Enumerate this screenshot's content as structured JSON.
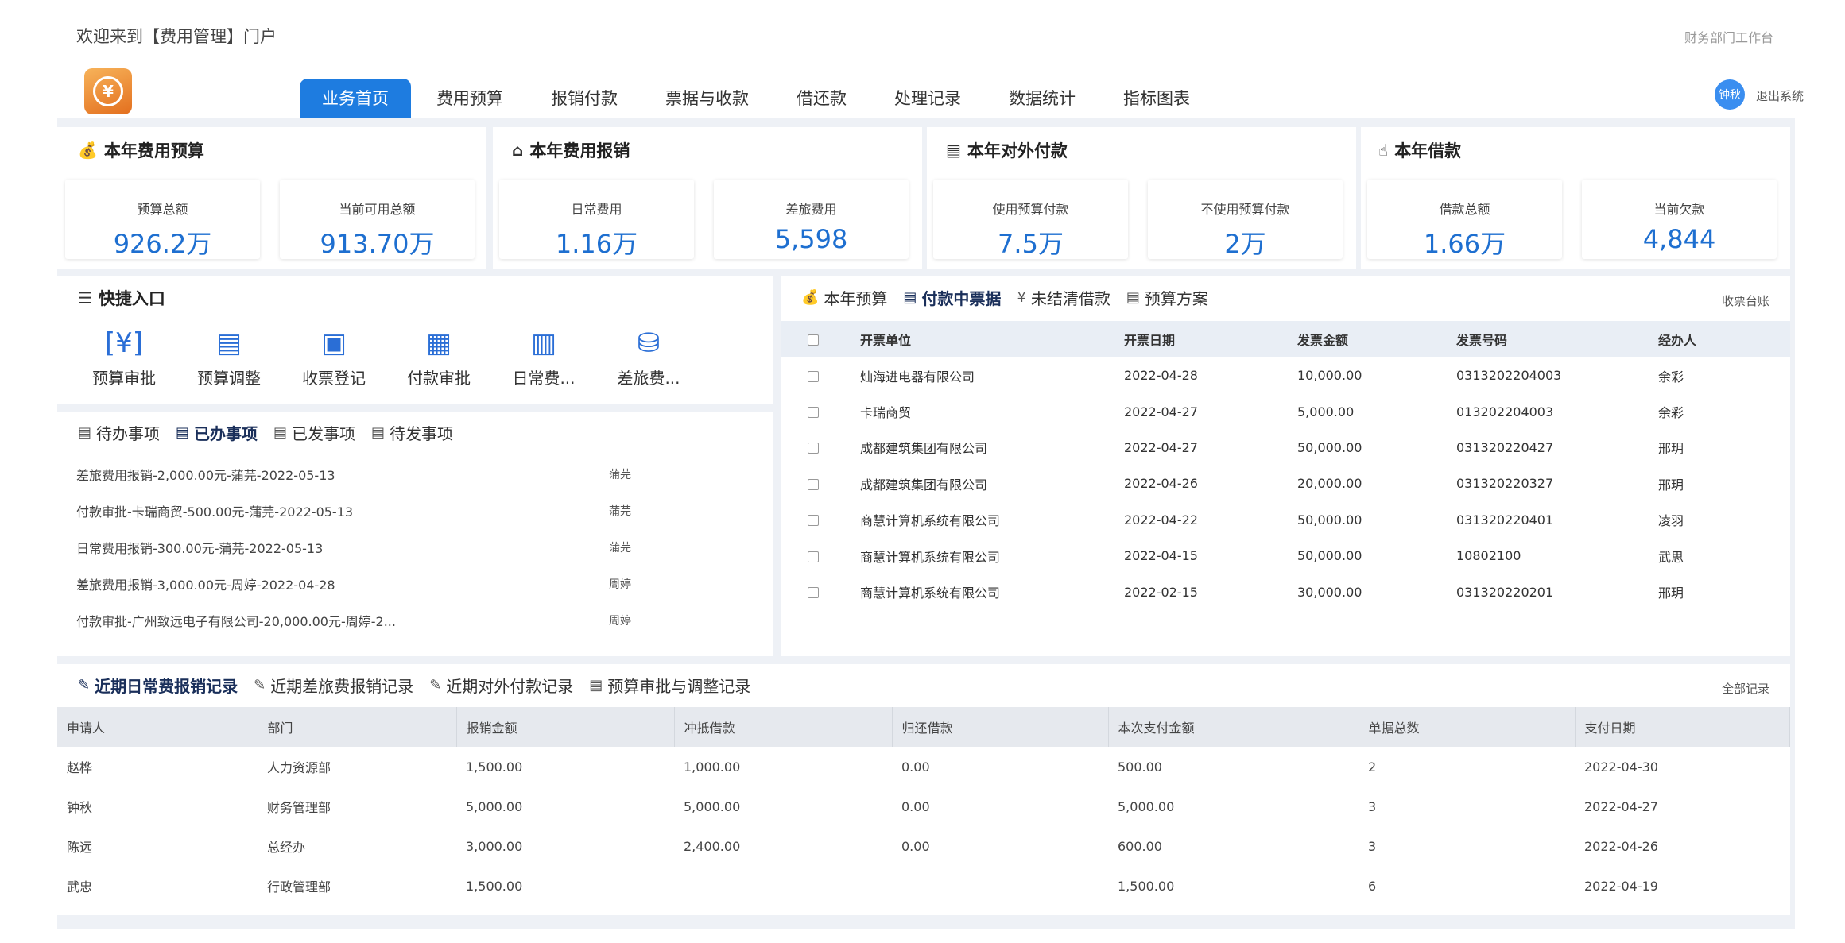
{
  "header": {
    "welcome": "欢迎来到【费用管理】门户",
    "workbench": "财务部门工作台",
    "user_name": "钟秋",
    "logout": "退出系统"
  },
  "nav": [
    {
      "label": "业务首页",
      "active": true
    },
    {
      "label": "费用预算"
    },
    {
      "label": "报销付款"
    },
    {
      "label": "票据与收款"
    },
    {
      "label": "借还款"
    },
    {
      "label": "处理记录"
    },
    {
      "label": "数据统计"
    },
    {
      "label": "指标图表"
    }
  ],
  "cards": [
    {
      "title": "本年费用预算",
      "icon": "money-bag-icon",
      "stats": [
        {
          "label": "预算总额",
          "value": "926.2万"
        },
        {
          "label": "当前可用总额",
          "value": "913.70万"
        }
      ]
    },
    {
      "title": "本年费用报销",
      "icon": "house-icon",
      "stats": [
        {
          "label": "日常费用",
          "value": "1.16万"
        },
        {
          "label": "差旅费用",
          "value": "5,598"
        }
      ]
    },
    {
      "title": "本年对外付款",
      "icon": "newspaper-icon",
      "stats": [
        {
          "label": "使用预算付款",
          "value": "7.5万"
        },
        {
          "label": "不使用预算付款",
          "value": "2万"
        }
      ]
    },
    {
      "title": "本年借款",
      "icon": "hand-money-icon",
      "stats": [
        {
          "label": "借款总额",
          "value": "1.66万"
        },
        {
          "label": "当前欠款",
          "value": "4,844"
        }
      ]
    }
  ],
  "quick": {
    "title": "快捷入口",
    "items": [
      {
        "label": "预算审批",
        "icon": "yen-scan-icon"
      },
      {
        "label": "预算调整",
        "icon": "document-icon"
      },
      {
        "label": "收票登记",
        "icon": "wallet-icon"
      },
      {
        "label": "付款审批",
        "icon": "newspaper-icon"
      },
      {
        "label": "日常费...",
        "icon": "receipt-icon"
      },
      {
        "label": "差旅费...",
        "icon": "coins-icon"
      }
    ]
  },
  "todo": {
    "tabs": [
      {
        "label": "待办事项"
      },
      {
        "label": "已办事项",
        "active": true
      },
      {
        "label": "已发事项"
      },
      {
        "label": "待发事项"
      }
    ],
    "rows": [
      {
        "text": "差旅费用报销-2,000.00元-蒲芫-2022-05-13",
        "person": "蒲芫"
      },
      {
        "text": "付款审批-卡瑞商贸-500.00元-蒲芫-2022-05-13",
        "person": "蒲芫"
      },
      {
        "text": "日常费用报销-300.00元-蒲芫-2022-05-13",
        "person": "蒲芫"
      },
      {
        "text": "差旅费用报销-3,000.00元-周婷-2022-04-28",
        "person": "周婷"
      },
      {
        "text": "付款审批-广州致远电子有限公司-20,000.00元-周婷-2...",
        "person": "周婷"
      }
    ]
  },
  "invoice": {
    "tabs": [
      {
        "label": "本年预算",
        "icon": "money-bag-icon"
      },
      {
        "label": "付款中票据",
        "icon": "receipt-icon",
        "active": true
      },
      {
        "label": "未结清借款",
        "icon": "yen-circle-icon"
      },
      {
        "label": "预算方案",
        "icon": "document-icon"
      }
    ],
    "link": "收票台账",
    "columns": [
      "开票单位",
      "开票日期",
      "发票金额",
      "发票号码",
      "经办人"
    ],
    "rows": [
      [
        "灿海进电器有限公司",
        "2022-04-28",
        "10,000.00",
        "0313202204003",
        "余彩"
      ],
      [
        "卡瑞商贸",
        "2022-04-27",
        "5,000.00",
        "013202204003",
        "余彩"
      ],
      [
        "成都建筑集团有限公司",
        "2022-04-27",
        "50,000.00",
        "031320220427",
        "邢玥"
      ],
      [
        "成都建筑集团有限公司",
        "2022-04-26",
        "20,000.00",
        "031320220327",
        "邢玥"
      ],
      [
        "商慧计算机系统有限公司",
        "2022-04-22",
        "50,000.00",
        "031320220401",
        "凌羽"
      ],
      [
        "商慧计算机系统有限公司",
        "2022-04-15",
        "50,000.00",
        "10802100",
        "武思"
      ],
      [
        "商慧计算机系统有限公司",
        "2022-02-15",
        "30,000.00",
        "031320220201",
        "邢玥"
      ]
    ]
  },
  "records": {
    "tabs": [
      {
        "label": "近期日常费报销记录",
        "active": true
      },
      {
        "label": "近期差旅费报销记录"
      },
      {
        "label": "近期对外付款记录"
      },
      {
        "label": "预算审批与调整记录"
      }
    ],
    "link": "全部记录",
    "columns": [
      "申请人",
      "部门",
      "报销金额",
      "冲抵借款",
      "归还借款",
      "本次支付金额",
      "单据总数",
      "支付日期"
    ],
    "rows": [
      [
        "赵桦",
        "人力资源部",
        "1,500.00",
        "1,000.00",
        "0.00",
        "500.00",
        "2",
        "2022-04-30"
      ],
      [
        "钟秋",
        "财务管理部",
        "5,000.00",
        "5,000.00",
        "0.00",
        "5,000.00",
        "3",
        "2022-04-27"
      ],
      [
        "陈远",
        "总经办",
        "3,000.00",
        "2,400.00",
        "0.00",
        "600.00",
        "3",
        "2022-04-26"
      ],
      [
        "武忠",
        "行政管理部",
        "1,500.00",
        "",
        "",
        "1,500.00",
        "6",
        "2022-04-19"
      ]
    ]
  },
  "colors": {
    "accent": "#1e7ce0",
    "stat_value": "#1e6fd0",
    "panel_bg": "#eef1f6"
  }
}
